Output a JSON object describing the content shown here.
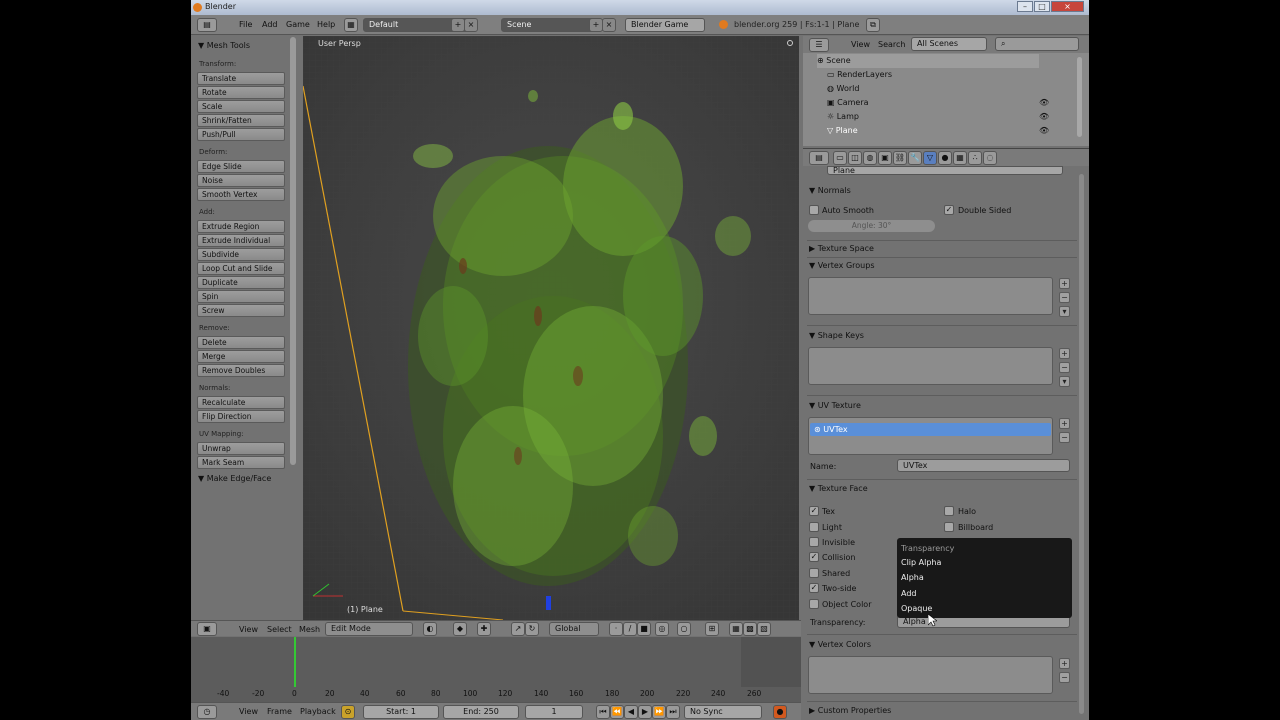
{
  "window": {
    "title": "Blender",
    "controls": [
      "–",
      "□",
      "×"
    ]
  },
  "infobar": {
    "menus": [
      "File",
      "Add",
      "Game",
      "Help"
    ],
    "screen_layout": "Default",
    "scene": "Scene",
    "engine": "Blender Game",
    "stats": "blender.org 259 | Fs:1-1 | Plane"
  },
  "toolshelf": {
    "title": "Mesh Tools",
    "groups": [
      {
        "label": "Transform:",
        "items": [
          "Translate",
          "Rotate",
          "Scale",
          "Shrink/Fatten",
          "Push/Pull"
        ]
      },
      {
        "label": "Deform:",
        "items": [
          "Edge Slide",
          "Noise",
          "Smooth Vertex"
        ]
      },
      {
        "label": "Add:",
        "items": [
          "Extrude Region",
          "Extrude Individual",
          "Subdivide",
          "Loop Cut and Slide",
          "Duplicate",
          "Spin",
          "Screw"
        ]
      },
      {
        "label": "Remove:",
        "items": [
          "Delete",
          "Merge",
          "Remove Doubles"
        ]
      },
      {
        "label": "Normals:",
        "items": [
          "Recalculate",
          "Flip Direction"
        ]
      },
      {
        "label": "UV Mapping:",
        "items": [
          "Unwrap",
          "Mark Seam"
        ]
      }
    ],
    "collapsed_panel": "Make Edge/Face"
  },
  "viewport": {
    "view_name": "User Persp",
    "object_label": "(1) Plane"
  },
  "view3d_header": {
    "menus": [
      "View",
      "Select",
      "Mesh"
    ],
    "mode": "Edit Mode",
    "orientation": "Global"
  },
  "timeline": {
    "ticks": [
      "-40",
      "-20",
      "0",
      "20",
      "40",
      "60",
      "80",
      "100",
      "120",
      "140",
      "160",
      "180",
      "200",
      "220",
      "240",
      "260"
    ],
    "menus": [
      "View",
      "Frame",
      "Playback"
    ],
    "start": "Start: 1",
    "end": "End: 250",
    "current": "1",
    "sync": "No Sync"
  },
  "outliner": {
    "menus": [
      "View",
      "Search"
    ],
    "display": "All Scenes",
    "tree": [
      "Scene",
      "RenderLayers",
      "World",
      "Camera",
      "Lamp",
      "Plane"
    ]
  },
  "properties": {
    "context_field": "Plane",
    "normals": {
      "header": "Normals",
      "auto_smooth": "Auto Smooth",
      "double_sided": "Double Sided",
      "angle": "Angle: 30°"
    },
    "texture_space": "Texture Space",
    "vertex_groups": "Vertex Groups",
    "shape_keys": "Shape Keys",
    "uv_texture": {
      "header": "UV Texture",
      "item": "UVTex",
      "name_label": "Name:",
      "name_value": "UVTex"
    },
    "texture_face": {
      "header": "Texture Face",
      "left": [
        "Tex",
        "Light",
        "Invisible",
        "Collision",
        "Shared",
        "Two-side",
        "Object Color"
      ],
      "left_checked": [
        true,
        false,
        false,
        true,
        false,
        true,
        false
      ],
      "right": [
        "Halo",
        "Billboard"
      ],
      "transparency_label": "Transparency:",
      "transparency_value": "Alpha"
    },
    "vertex_colors": "Vertex Colors",
    "custom_properties": "Custom Properties"
  },
  "transparency_menu": {
    "title": "Transparency",
    "options": [
      "Clip Alpha",
      "Alpha",
      "Add",
      "Opaque"
    ]
  }
}
